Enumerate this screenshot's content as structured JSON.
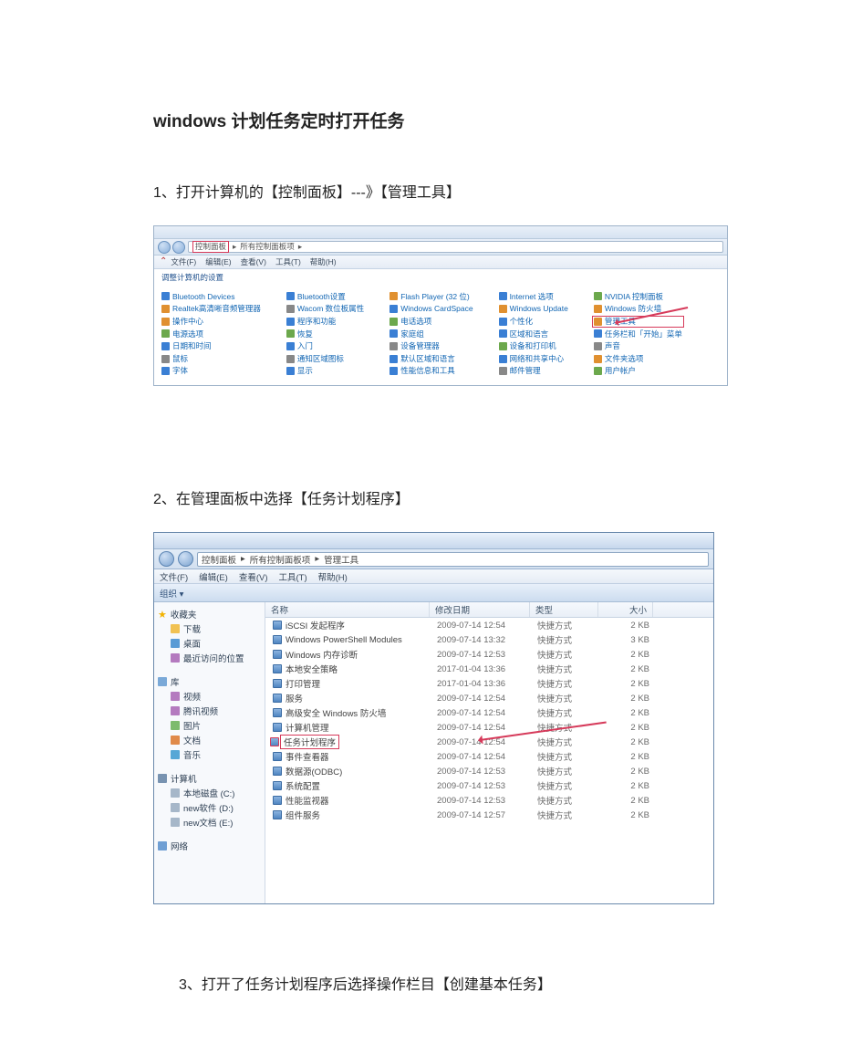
{
  "doc_title": "windows 计划任务定时打开任务",
  "step1": "1、打开计算机的【控制面板】---》【管理工具】",
  "step2": "2、在管理面板中选择【任务计划程序】",
  "step3": "3、打开了任务计划程序后选择操作栏目【创建基本任务】",
  "cp": {
    "breadcrumb": {
      "root": "控制面板",
      "sep": "▸",
      "current": "所有控制面板项",
      "arrow": "▸"
    },
    "menus": [
      "文件(F)",
      "编辑(E)",
      "查看(V)",
      "工具(T)",
      "帮助(H)"
    ],
    "settings_label": "调整计算机的设置",
    "cols": [
      [
        {
          "t": "Bluetooth Devices",
          "c": "blue"
        },
        {
          "t": "Realtek高清晰音频管理器",
          "c": "orange"
        },
        {
          "t": "操作中心",
          "c": "flag"
        },
        {
          "t": "电源选项",
          "c": "green"
        },
        {
          "t": "日期和时间",
          "c": "blue"
        },
        {
          "t": "鼠标",
          "c": "gray"
        },
        {
          "t": "字体",
          "c": "blue"
        }
      ],
      [
        {
          "t": "Bluetooth设置",
          "c": "blue"
        },
        {
          "t": "Wacom 数位板属性",
          "c": "gray"
        },
        {
          "t": "程序和功能",
          "c": "blue"
        },
        {
          "t": "恢复",
          "c": "green"
        },
        {
          "t": "入门",
          "c": "blue"
        },
        {
          "t": "通知区域图标",
          "c": "gray"
        },
        {
          "t": "显示",
          "c": "blue"
        }
      ],
      [
        {
          "t": "Flash Player (32 位)",
          "c": "orange"
        },
        {
          "t": "Windows CardSpace",
          "c": "blue"
        },
        {
          "t": "电话选项",
          "c": "green"
        },
        {
          "t": "家庭组",
          "c": "blue"
        },
        {
          "t": "设备管理器",
          "c": "gray"
        },
        {
          "t": "默认区域和语言",
          "c": "blue"
        },
        {
          "t": "性能信息和工具",
          "c": "blue"
        }
      ],
      [
        {
          "t": "Internet 选项",
          "c": "blue"
        },
        {
          "t": "Windows Update",
          "c": "orange"
        },
        {
          "t": "个性化",
          "c": "blue"
        },
        {
          "t": "区域和语言",
          "c": "blue"
        },
        {
          "t": "设备和打印机",
          "c": "green"
        },
        {
          "t": "网络和共享中心",
          "c": "blue"
        },
        {
          "t": "邮件管理",
          "c": "gray"
        }
      ],
      [
        {
          "t": "NVIDIA 控制面板",
          "c": "green"
        },
        {
          "t": "Windows 防火墙",
          "c": "orange",
          "hl": false
        },
        {
          "t": "管理工具",
          "c": "orange",
          "hl": true
        },
        {
          "t": "任务栏和「开始」菜单",
          "c": "blue"
        },
        {
          "t": "声音",
          "c": "gray"
        },
        {
          "t": "文件夹选项",
          "c": "orange"
        },
        {
          "t": "用户帐户",
          "c": "green"
        }
      ]
    ]
  },
  "ex": {
    "breadcrumb": {
      "p1": "控制面板",
      "p2": "所有控制面板项",
      "p3": "管理工具",
      "sep": "▸"
    },
    "menus": [
      "文件(F)",
      "编辑(E)",
      "查看(V)",
      "工具(T)",
      "帮助(H)"
    ],
    "toolbar_label": "组织 ▾",
    "headers": {
      "name": "名称",
      "date": "修改日期",
      "type": "类型",
      "size": "大小"
    },
    "sidebar": {
      "fav_header": "收藏夹",
      "fav": [
        "下载",
        "桌面",
        "最近访问的位置"
      ],
      "lib_header": "库",
      "lib": [
        "视频",
        "腾讯视频",
        "图片",
        "文档",
        "音乐"
      ],
      "pc_header": "计算机",
      "pc": [
        "本地磁盘 (C:)",
        "new软件 (D:)",
        "new文档 (E:)"
      ],
      "net_header": "网络"
    },
    "files": [
      {
        "n": "iSCSI 发起程序",
        "d": "2009-07-14 12:54",
        "t": "快捷方式",
        "s": "2 KB"
      },
      {
        "n": "Windows PowerShell Modules",
        "d": "2009-07-14 13:32",
        "t": "快捷方式",
        "s": "3 KB"
      },
      {
        "n": "Windows 内存诊断",
        "d": "2009-07-14 12:53",
        "t": "快捷方式",
        "s": "2 KB"
      },
      {
        "n": "本地安全策略",
        "d": "2017-01-04 13:36",
        "t": "快捷方式",
        "s": "2 KB"
      },
      {
        "n": "打印管理",
        "d": "2017-01-04 13:36",
        "t": "快捷方式",
        "s": "2 KB"
      },
      {
        "n": "服务",
        "d": "2009-07-14 12:54",
        "t": "快捷方式",
        "s": "2 KB"
      },
      {
        "n": "高级安全 Windows 防火墙",
        "d": "2009-07-14 12:54",
        "t": "快捷方式",
        "s": "2 KB"
      },
      {
        "n": "计算机管理",
        "d": "2009-07-14 12:54",
        "t": "快捷方式",
        "s": "2 KB"
      },
      {
        "n": "任务计划程序",
        "d": "2009-07-14 12:54",
        "t": "快捷方式",
        "s": "2 KB",
        "hl": true
      },
      {
        "n": "事件查看器",
        "d": "2009-07-14 12:54",
        "t": "快捷方式",
        "s": "2 KB"
      },
      {
        "n": "数据源(ODBC)",
        "d": "2009-07-14 12:53",
        "t": "快捷方式",
        "s": "2 KB"
      },
      {
        "n": "系统配置",
        "d": "2009-07-14 12:53",
        "t": "快捷方式",
        "s": "2 KB"
      },
      {
        "n": "性能监视器",
        "d": "2009-07-14 12:53",
        "t": "快捷方式",
        "s": "2 KB"
      },
      {
        "n": "组件服务",
        "d": "2009-07-14 12:57",
        "t": "快捷方式",
        "s": "2 KB"
      }
    ]
  }
}
